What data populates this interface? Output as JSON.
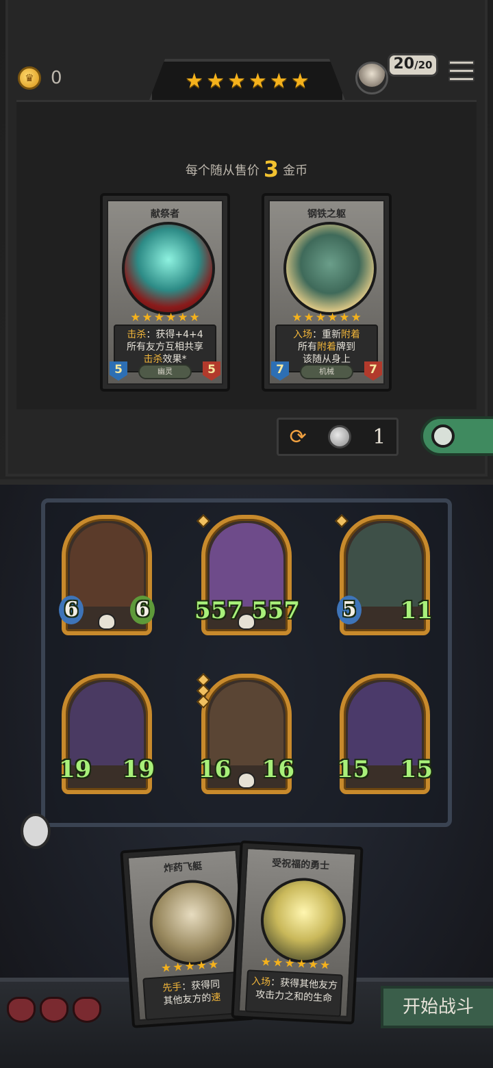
{
  "hud": {
    "gold": "0",
    "population": {
      "current": "20",
      "max": "/20"
    },
    "tier_stars": 6
  },
  "shop": {
    "price_prefix": "每个随从售价",
    "price_value": "3",
    "price_suffix": "金币",
    "refresh_cost": "1",
    "cards": [
      {
        "name": "献祭者",
        "stars": 6,
        "text_line1_hl": "击杀",
        "text_line1": "：获得+4+4",
        "text_line2": "所有友方互相共享",
        "text_line3_hl": "击杀",
        "text_line3": "效果*",
        "tribe": "幽灵",
        "attack": "5",
        "health": "5"
      },
      {
        "name": "钢铁之躯",
        "stars": 6,
        "text_line1_hl": "入场",
        "text_line1": "：重新",
        "text_line1_hl2": "附着",
        "text_line2": "所有",
        "text_line2_hl": "附着",
        "text_line2_end": "牌到",
        "text_line3": "该随从身上",
        "tribe": "机械",
        "attack": "7",
        "health": "7"
      }
    ]
  },
  "board": {
    "minions": [
      {
        "attack": "6",
        "health": "6",
        "art": "#5b3b2a"
      },
      {
        "attack": "557",
        "health": "557",
        "art": "#6e4b8a"
      },
      {
        "attack": "5",
        "health": "11",
        "art": "#3e5048"
      },
      {
        "attack": "19",
        "health": "19",
        "art": "#4a3a62"
      },
      {
        "attack": "16",
        "health": "16",
        "art": "#5a4534"
      },
      {
        "attack": "15",
        "health": "15",
        "art": "#4b3a6a"
      }
    ]
  },
  "hand": [
    {
      "name": "炸药飞艇",
      "text_hl": "先手",
      "text1": "：获得同",
      "text2": "其他友方的",
      "text2_hl": "速"
    },
    {
      "name": "受祝福的勇士",
      "text_hl": "入场",
      "text1": "：获得其他友方",
      "text2": "攻击力之和的生命"
    }
  ],
  "lives": 3,
  "start_button": "开始战斗",
  "colors": {
    "gold": "#f2c230",
    "star": "#f5b21c",
    "highlight": "#f2b63a",
    "frame": "#c88a2c"
  }
}
